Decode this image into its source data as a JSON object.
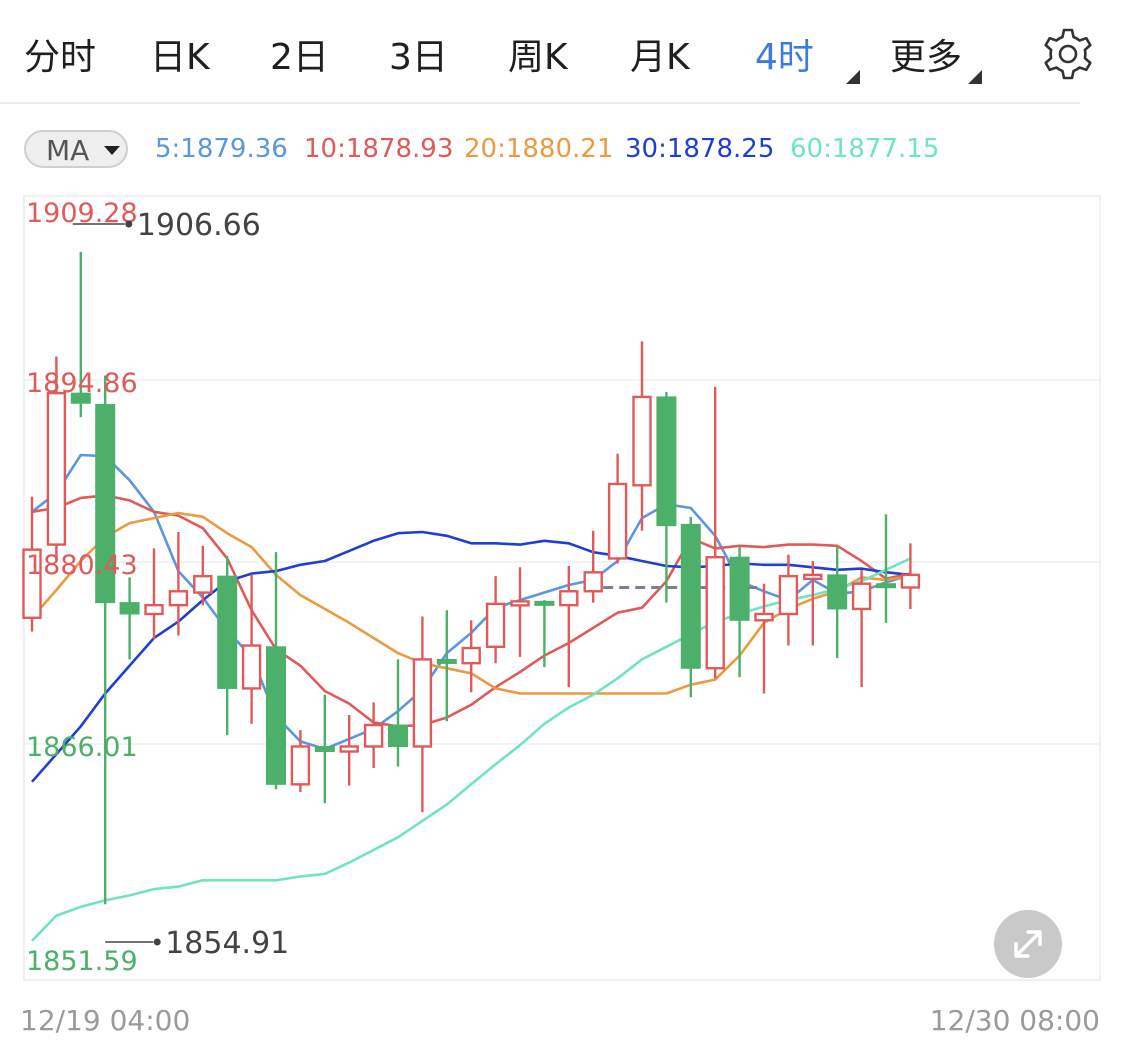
{
  "tabs": [
    {
      "label": "分时",
      "active": false
    },
    {
      "label": "日K",
      "active": false
    },
    {
      "label": "2日",
      "active": false
    },
    {
      "label": "3日",
      "active": false
    },
    {
      "label": "周K",
      "active": false
    },
    {
      "label": "月K",
      "active": false
    },
    {
      "label": "4时",
      "active": true
    },
    {
      "label": "更多",
      "active": false
    }
  ],
  "icons": {
    "settings": "gear-icon",
    "expand": "expand-arrows-icon",
    "dropdown": "caret-down-icon"
  },
  "ma_selector": {
    "label": "MA"
  },
  "ma_legend": [
    {
      "label": "5:1879.36",
      "color": "#5b96e0"
    },
    {
      "label": "10:1878.93",
      "color": "#e05a5a"
    },
    {
      "label": "20:1880.21",
      "color": "#eb9a41"
    },
    {
      "label": "30:1878.25",
      "color": "#1f3fcf"
    },
    {
      "label": "60:1877.15",
      "color": "#6fe3c4"
    }
  ],
  "colors": {
    "up": "#e05a5a",
    "down": "#4caf6a",
    "accent": "#3d7be0"
  },
  "chart_data": {
    "type": "candlestick",
    "y_axis_labels": [
      {
        "value": 1909.28,
        "text": "1909.28",
        "color": "#e05a5a"
      },
      {
        "value": 1894.86,
        "text": "1894.86",
        "color": "#e05a5a"
      },
      {
        "value": 1880.43,
        "text": "1880.43",
        "color": "#e05a5a"
      },
      {
        "value": 1866.01,
        "text": "1866.01",
        "color": "#4caf6a"
      },
      {
        "value": 1851.59,
        "text": "1851.59",
        "color": "#4caf6a"
      }
    ],
    "ylim": [
      1851.59,
      1909.28
    ],
    "x_axis_labels": [
      "12/19 04:00",
      "12/30 08:00"
    ],
    "grid": true,
    "max_marker": {
      "value": 1906.66,
      "text": "1906.66",
      "index": 2
    },
    "min_marker": {
      "value": 1854.91,
      "text": "1854.91",
      "index": 3
    },
    "last_price_line": {
      "value": 1880.0
    },
    "candles": [
      [
        1877.6,
        1883.0,
        1887.2,
        1876.5
      ],
      [
        1883.4,
        1895.4,
        1898.3,
        1882.2
      ],
      [
        1895.4,
        1894.6,
        1906.6,
        1893.5
      ],
      [
        1894.5,
        1878.8,
        1896.8,
        1854.9
      ],
      [
        1878.8,
        1877.9,
        1880.8,
        1874.3
      ],
      [
        1877.9,
        1878.6,
        1883.1,
        1875.9
      ],
      [
        1878.6,
        1879.7,
        1884.4,
        1876.2
      ],
      [
        1879.6,
        1880.9,
        1883.3,
        1878.6
      ],
      [
        1880.9,
        1872.0,
        1882.5,
        1868.3
      ],
      [
        1872.0,
        1875.4,
        1881.0,
        1869.2
      ],
      [
        1875.3,
        1864.4,
        1882.8,
        1864.0
      ],
      [
        1864.4,
        1867.4,
        1868.7,
        1863.8
      ],
      [
        1867.4,
        1867.0,
        1871.5,
        1862.9
      ],
      [
        1867.0,
        1867.4,
        1869.9,
        1864.3
      ],
      [
        1867.4,
        1869.1,
        1870.9,
        1865.7
      ],
      [
        1869.1,
        1867.4,
        1874.3,
        1865.8
      ],
      [
        1867.4,
        1874.3,
        1877.7,
        1862.2
      ],
      [
        1874.3,
        1874.0,
        1878.2,
        1869.4
      ],
      [
        1874.0,
        1875.2,
        1877.4,
        1871.7
      ],
      [
        1875.3,
        1878.7,
        1880.9,
        1874.0
      ],
      [
        1878.6,
        1878.9,
        1881.6,
        1874.5
      ],
      [
        1878.9,
        1878.7,
        1879.0,
        1873.7
      ],
      [
        1878.6,
        1879.7,
        1881.7,
        1872.1
      ],
      [
        1879.7,
        1881.2,
        1884.5,
        1878.8
      ],
      [
        1882.3,
        1888.2,
        1890.6,
        1881.9
      ],
      [
        1888.1,
        1895.1,
        1899.5,
        1884.5
      ],
      [
        1895.1,
        1884.9,
        1895.5,
        1878.8
      ],
      [
        1885.0,
        1873.6,
        1885.6,
        1871.3
      ],
      [
        1873.6,
        1882.4,
        1895.9,
        1872.8
      ],
      [
        1882.4,
        1877.4,
        1883.2,
        1872.9
      ],
      [
        1877.4,
        1877.9,
        1880.3,
        1871.6
      ],
      [
        1877.9,
        1880.9,
        1882.6,
        1875.4
      ],
      [
        1880.9,
        1881.0,
        1882.1,
        1875.4
      ],
      [
        1881.0,
        1878.3,
        1883.2,
        1874.4
      ],
      [
        1878.3,
        1880.3,
        1881.4,
        1872.1
      ],
      [
        1880.3,
        1880.0,
        1885.8,
        1877.2
      ],
      [
        1880.0,
        1881.0,
        1883.5,
        1878.3
      ]
    ],
    "series": [
      {
        "id": "ma5",
        "color": "#5b96e0",
        "values": [
          [
            0,
            1886.0
          ],
          [
            1,
            1887.5
          ],
          [
            2,
            1890.5
          ],
          [
            3,
            1890.4
          ],
          [
            4,
            1888.5
          ],
          [
            5,
            1886.0
          ],
          [
            6,
            1881.3
          ],
          [
            7,
            1879.2
          ],
          [
            8,
            1876.6
          ],
          [
            9,
            1874.5
          ],
          [
            10,
            1869.8
          ],
          [
            11,
            1867.8
          ],
          [
            12,
            1867.2
          ],
          [
            13,
            1868.0
          ],
          [
            14,
            1868.8
          ],
          [
            15,
            1870.2
          ],
          [
            16,
            1871.9
          ],
          [
            17,
            1874.8
          ],
          [
            18,
            1876.4
          ],
          [
            19,
            1878.4
          ],
          [
            20,
            1879.0
          ],
          [
            21,
            1879.6
          ],
          [
            22,
            1880.2
          ],
          [
            23,
            1880.6
          ],
          [
            24,
            1882.1
          ],
          [
            25,
            1885.5
          ],
          [
            26,
            1886.6
          ],
          [
            27,
            1886.3
          ],
          [
            28,
            1884.1
          ],
          [
            29,
            1880.5
          ],
          [
            30,
            1879.7
          ],
          [
            31,
            1879.0
          ],
          [
            32,
            1880.6
          ],
          [
            33,
            1879.5
          ],
          [
            34,
            1879.7
          ],
          [
            35,
            1880.4
          ],
          [
            36,
            1881.0
          ]
        ]
      },
      {
        "id": "ma10",
        "color": "#e05a5a",
        "values": [
          [
            0,
            1886.0
          ],
          [
            1,
            1886.3
          ],
          [
            2,
            1887.1
          ],
          [
            3,
            1887.3
          ],
          [
            4,
            1886.9
          ],
          [
            5,
            1886.0
          ],
          [
            6,
            1885.7
          ],
          [
            7,
            1884.7
          ],
          [
            8,
            1882.3
          ],
          [
            9,
            1878.2
          ],
          [
            10,
            1875.1
          ],
          [
            11,
            1873.8
          ],
          [
            12,
            1871.8
          ],
          [
            13,
            1870.8
          ],
          [
            14,
            1869.3
          ],
          [
            15,
            1869.0
          ],
          [
            16,
            1869.1
          ],
          [
            17,
            1869.7
          ],
          [
            18,
            1870.7
          ],
          [
            19,
            1872.1
          ],
          [
            20,
            1873.3
          ],
          [
            21,
            1874.6
          ],
          [
            22,
            1875.6
          ],
          [
            23,
            1876.8
          ],
          [
            24,
            1878.0
          ],
          [
            25,
            1878.4
          ],
          [
            26,
            1880.5
          ],
          [
            27,
            1883.9
          ],
          [
            28,
            1883.1
          ],
          [
            29,
            1883.3
          ],
          [
            30,
            1883.2
          ],
          [
            31,
            1883.4
          ],
          [
            32,
            1883.4
          ],
          [
            33,
            1883.3
          ],
          [
            34,
            1882.1
          ],
          [
            35,
            1880.7
          ],
          [
            36,
            1881.1
          ]
        ]
      },
      {
        "id": "ma20",
        "color": "#eb9a41",
        "values": [
          [
            0,
            1877.6
          ],
          [
            1,
            1879.8
          ],
          [
            2,
            1882.1
          ],
          [
            3,
            1884.0
          ],
          [
            4,
            1885.1
          ],
          [
            5,
            1885.5
          ],
          [
            6,
            1885.9
          ],
          [
            7,
            1885.6
          ],
          [
            8,
            1884.3
          ],
          [
            9,
            1883.2
          ],
          [
            10,
            1881.0
          ],
          [
            11,
            1879.4
          ],
          [
            12,
            1878.3
          ],
          [
            13,
            1877.2
          ],
          [
            14,
            1876.0
          ],
          [
            15,
            1874.8
          ],
          [
            16,
            1874.0
          ],
          [
            17,
            1873.6
          ],
          [
            18,
            1873.2
          ],
          [
            19,
            1872.0
          ],
          [
            20,
            1871.6
          ],
          [
            21,
            1871.6
          ],
          [
            22,
            1871.6
          ],
          [
            23,
            1871.6
          ],
          [
            24,
            1871.6
          ],
          [
            25,
            1871.6
          ],
          [
            26,
            1871.6
          ],
          [
            27,
            1872.3
          ],
          [
            28,
            1872.7
          ],
          [
            29,
            1874.6
          ],
          [
            30,
            1877.2
          ],
          [
            31,
            1878.3
          ],
          [
            32,
            1879.1
          ],
          [
            33,
            1879.7
          ],
          [
            34,
            1880.8
          ],
          [
            35,
            1880.6
          ],
          [
            36,
            1880.9
          ]
        ]
      },
      {
        "id": "ma30",
        "color": "#1f3fcf",
        "values": [
          [
            0,
            1864.6
          ],
          [
            1,
            1866.8
          ],
          [
            2,
            1869.0
          ],
          [
            3,
            1871.6
          ],
          [
            4,
            1873.8
          ],
          [
            5,
            1876.0
          ],
          [
            6,
            1877.3
          ],
          [
            7,
            1879.0
          ],
          [
            8,
            1880.5
          ],
          [
            9,
            1881.1
          ],
          [
            10,
            1881.3
          ],
          [
            11,
            1881.8
          ],
          [
            12,
            1882.1
          ],
          [
            13,
            1882.9
          ],
          [
            14,
            1883.7
          ],
          [
            15,
            1884.3
          ],
          [
            16,
            1884.4
          ],
          [
            17,
            1884.1
          ],
          [
            18,
            1883.5
          ],
          [
            19,
            1883.5
          ],
          [
            20,
            1883.4
          ],
          [
            21,
            1883.7
          ],
          [
            22,
            1883.5
          ],
          [
            23,
            1882.8
          ],
          [
            24,
            1882.5
          ],
          [
            25,
            1882.1
          ],
          [
            26,
            1881.7
          ],
          [
            27,
            1881.6
          ],
          [
            28,
            1881.7
          ],
          [
            29,
            1881.9
          ],
          [
            30,
            1881.8
          ],
          [
            31,
            1881.8
          ],
          [
            32,
            1881.6
          ],
          [
            33,
            1881.4
          ],
          [
            34,
            1881.5
          ],
          [
            35,
            1881.2
          ],
          [
            36,
            1881.0
          ]
        ]
      },
      {
        "id": "ma60",
        "color": "#6fe3c4",
        "values": [
          [
            0,
            1852.0
          ],
          [
            1,
            1854.0
          ],
          [
            2,
            1854.7
          ],
          [
            3,
            1855.2
          ],
          [
            4,
            1855.6
          ],
          [
            5,
            1856.1
          ],
          [
            6,
            1856.3
          ],
          [
            7,
            1856.8
          ],
          [
            8,
            1856.8
          ],
          [
            9,
            1856.8
          ],
          [
            10,
            1856.8
          ],
          [
            11,
            1857.1
          ],
          [
            12,
            1857.3
          ],
          [
            13,
            1858.2
          ],
          [
            14,
            1859.2
          ],
          [
            15,
            1860.2
          ],
          [
            16,
            1861.5
          ],
          [
            17,
            1862.8
          ],
          [
            18,
            1864.4
          ],
          [
            19,
            1866.0
          ],
          [
            20,
            1867.5
          ],
          [
            21,
            1869.2
          ],
          [
            22,
            1870.5
          ],
          [
            23,
            1871.5
          ],
          [
            24,
            1872.8
          ],
          [
            25,
            1874.3
          ],
          [
            26,
            1875.3
          ],
          [
            27,
            1876.3
          ],
          [
            28,
            1877.3
          ],
          [
            29,
            1877.9
          ],
          [
            30,
            1878.5
          ],
          [
            31,
            1879.0
          ],
          [
            32,
            1879.4
          ],
          [
            33,
            1879.9
          ],
          [
            34,
            1880.5
          ],
          [
            35,
            1881.4
          ],
          [
            36,
            1882.3
          ]
        ]
      }
    ]
  }
}
